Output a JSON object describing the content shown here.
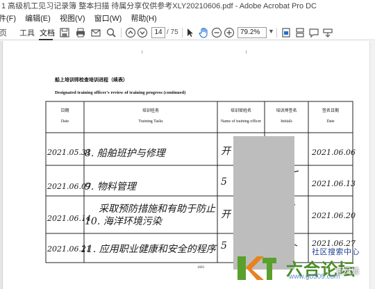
{
  "window": {
    "title": "1 高级机工见习记录簿 整本扫描 待属分享仅供参考XLY20210606.pdf - Adobe Acrobat Pro DC"
  },
  "menu": [
    "件(F)",
    "编辑(E)",
    "视图(V)",
    "窗口(W)",
    "帮助(H)"
  ],
  "toolbar": {
    "tabs": [
      "页",
      "工具",
      "文档"
    ],
    "active_tab": "文档",
    "current_page": "14",
    "total_pages": "/ 75",
    "zoom": "79.2%"
  },
  "document": {
    "top_marks": [
      "t",
      "t"
    ],
    "title_cn": "船上培训师检查培训进程（续表）",
    "title_en": "Designated training officer's review of training progress (continued)",
    "headers": [
      {
        "cn": "日期",
        "en": "Date"
      },
      {
        "cn": "培训任务",
        "en": "Training Tasks"
      },
      {
        "cn": "培训官姓名",
        "en": "Name of training officer"
      },
      {
        "cn": "培训师签名",
        "en": "Initials"
      },
      {
        "cn": "签名日期",
        "en": "Date"
      }
    ],
    "rows": [
      {
        "date": "2021.05.31",
        "task": "8. 船舶班护与修理",
        "name": "开",
        "sign_date": "2021.06.06"
      },
      {
        "date": "2021.06.07",
        "task": "9. 物料管理",
        "name": "5",
        "sign_date": "2021.06.13"
      },
      {
        "date": "2021.06.14",
        "task_line1": "采取预防措施和有助于防止",
        "task_line2": "10. 海洋环境污染",
        "name": "开",
        "sign_date": "2021.06.20"
      },
      {
        "date": "2021.06.21",
        "task": "11. 应用职业健康和安全的程序",
        "name": "5",
        "sign_date": "2021.06.27"
      }
    ],
    "page_number": "1693"
  },
  "watermark": {
    "top_text": "社区搜索中心",
    "brand": "六合论坛",
    "url": "www.go509.com",
    "user": "臣灵通"
  },
  "colors": {
    "toolbar_border": "#d4d4d4",
    "redaction": "#bdbdbd",
    "watermark_green": "#4a8d26",
    "watermark_blue": "#1e3f8f",
    "logo_orange": "#e8821e",
    "logo_green": "#5aa02c"
  }
}
